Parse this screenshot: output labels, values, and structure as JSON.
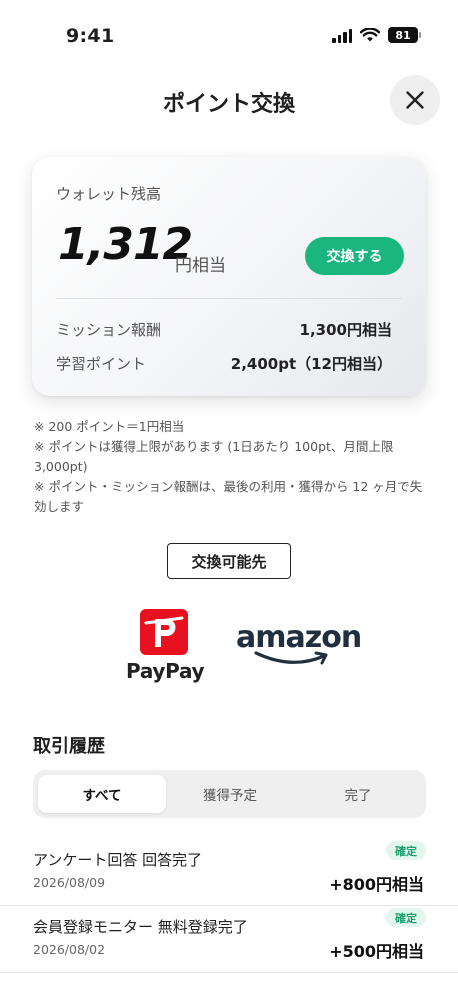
{
  "status_bar": {
    "time": "9:41",
    "battery": "81",
    "signal_icon": "signal-icon",
    "wifi_icon": "wifi-icon"
  },
  "header": {
    "title": "ポイント交換",
    "close_icon": "close-icon"
  },
  "wallet": {
    "label": "ウォレット残高",
    "amount": "1,312",
    "unit": "円相当",
    "exchange_button": "交換する",
    "rows": [
      {
        "label": "ミッション報酬",
        "value": "1,300円相当"
      },
      {
        "label": "学習ポイント",
        "value": "2,400pt（12円相当）"
      }
    ]
  },
  "notes": [
    "※ 200 ポイント＝1円相当",
    "※ ポイントは獲得上限があります (1日あたり 100pt、月間上限 3,000pt)",
    "※ ポイント・ミッション報酬は、最後の利用・獲得から 12 ヶ月で失効します"
  ],
  "destinations": {
    "button_label": "交換可能先",
    "paypay_label": "PayPay",
    "amazon_label": "amazon"
  },
  "history": {
    "title": "取引履歴",
    "tabs": [
      {
        "label": "すべて",
        "active": true
      },
      {
        "label": "獲得予定",
        "active": false
      },
      {
        "label": "完了",
        "active": false
      }
    ],
    "items": [
      {
        "title": "アンケート回答 回答完了",
        "date": "2026/08/09",
        "badge": "確定",
        "amount": "+800円相当"
      },
      {
        "title": "会員登録モニター 無料登録完了",
        "date": "2026/08/02",
        "badge": "確定",
        "amount": "+500円相当"
      }
    ]
  },
  "colors": {
    "accent": "#1bb57f",
    "paypay": "#e8111f",
    "amazon": "#ff9900",
    "badge_bg": "#e2f6ee"
  }
}
